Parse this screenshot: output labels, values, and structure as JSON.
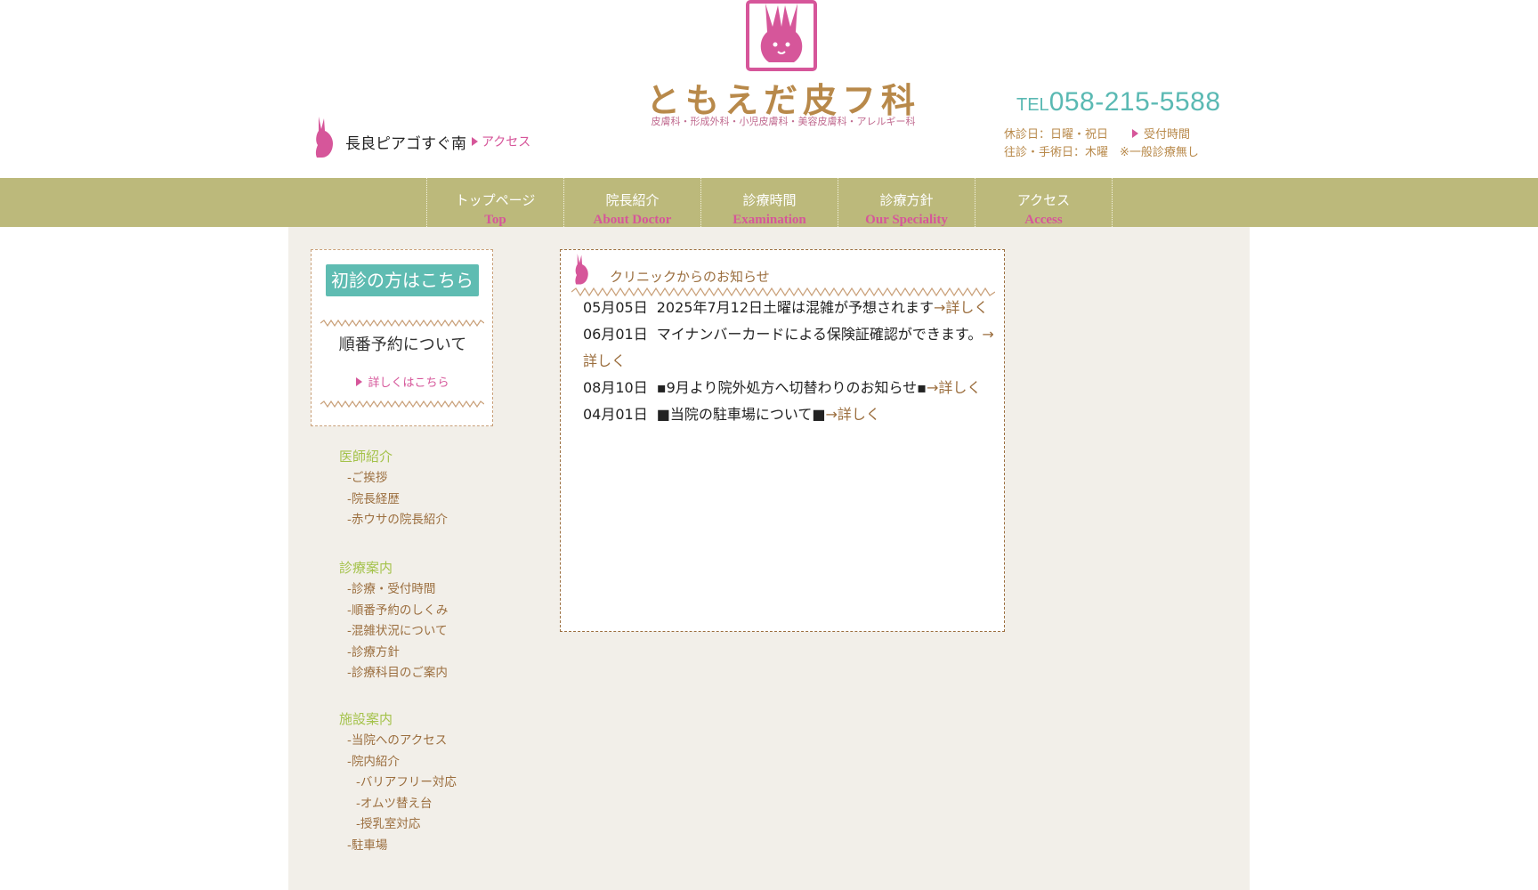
{
  "header": {
    "location_text": "長良ピアゴすぐ南",
    "access_link": "アクセス",
    "logo_title": "ともえだ皮フ科",
    "logo_subtitle": "皮膚科・形成外科・小児皮膚科・美容皮膚科・アレルギー科",
    "tel_prefix": "TEL",
    "tel_number": "058-215-5588",
    "closed_days": "休診日：日曜・祝日",
    "visit_days": "往診・手術日：木曜　※一般診療無し",
    "hours_link": "受付時間"
  },
  "nav": {
    "items": [
      {
        "jp": "トップページ",
        "en": "Top"
      },
      {
        "jp": "院長紹介",
        "en": "About Doctor"
      },
      {
        "jp": "診療時間",
        "en": "Examination"
      },
      {
        "jp": "診療方針",
        "en": "Our Speciality"
      },
      {
        "jp": "アクセス",
        "en": "Access"
      }
    ]
  },
  "sidebar": {
    "first_visit_button": "初診の方はこちら",
    "reservation_title": "順番予約について",
    "reservation_link": "詳しくはこちら",
    "groups": [
      {
        "heading": "医師紹介",
        "links": [
          "-ご挨拶",
          "-院長経歴",
          "-赤ウサの院長紹介"
        ]
      },
      {
        "heading": "診療案内",
        "links": [
          "-診療・受付時間",
          "-順番予約のしくみ",
          "-混雑状況について",
          "-診療方針",
          "-診療科目のご案内"
        ]
      },
      {
        "heading": "施設案内",
        "links": [
          "-当院へのアクセス",
          "-院内紹介",
          "-バリアフリー対応",
          "-オムツ替え台",
          "-授乳室対応",
          "-駐車場"
        ]
      }
    ]
  },
  "news": {
    "title": "クリニックからのお知らせ",
    "items": [
      {
        "date": "05月05日",
        "text": "2025年7月12日土曜は混雑が予想されます",
        "more": "→詳しく"
      },
      {
        "date": "06月01日",
        "text": "マイナンバーカードによる保険証確認ができます。",
        "more": "→詳しく"
      },
      {
        "date": "08月10日",
        "text": "▪9月より院外処方へ切替わりのお知らせ▪",
        "more": "→詳しく"
      },
      {
        "date": "04月01日",
        "text": "■当院の駐車場について■",
        "more": "→詳しく"
      }
    ]
  },
  "colors": {
    "nav_bg": "#bcb97b",
    "accent_pink": "#d6569a",
    "accent_teal": "#5fbcb2",
    "brown": "#9b6e3e",
    "main_bg": "#f2efe9"
  }
}
